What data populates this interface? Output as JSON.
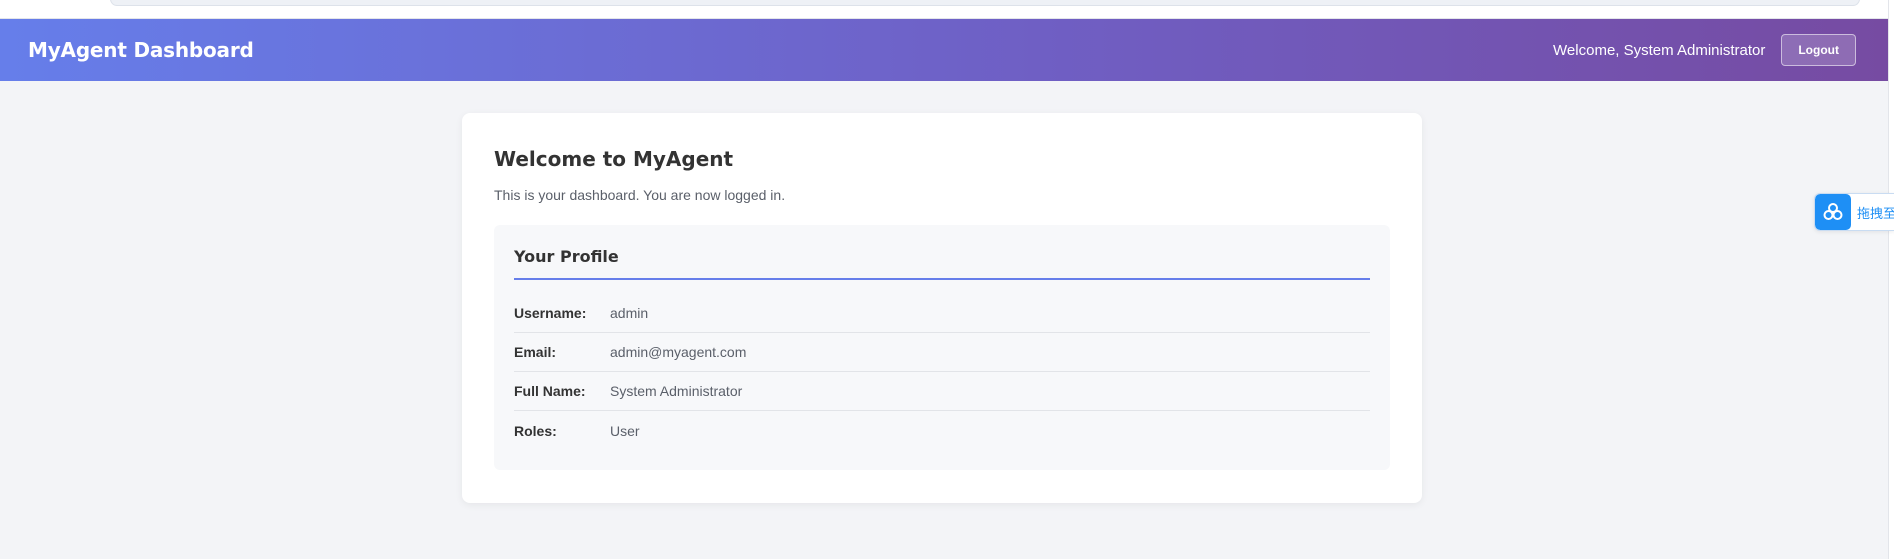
{
  "header": {
    "brand": "MyAgent Dashboard",
    "welcome": "Welcome, System Administrator",
    "logout_label": "Logout"
  },
  "card": {
    "title": "Welcome to MyAgent",
    "subtitle": "This is your dashboard. You are now logged in."
  },
  "profile": {
    "title": "Your Profile",
    "rows": [
      {
        "label": "Username:",
        "value": "admin"
      },
      {
        "label": "Email:",
        "value": "admin@myagent.com"
      },
      {
        "label": "Full Name:",
        "value": "System Administrator"
      },
      {
        "label": "Roles:",
        "value": "User"
      }
    ]
  },
  "widget": {
    "icon": "cloud-icon",
    "text": "拖拽至"
  },
  "colors": {
    "header_gradient_start": "#667eea",
    "header_gradient_end": "#764ba2",
    "accent": "#667eea",
    "widget_blue": "#1e8ff5"
  }
}
